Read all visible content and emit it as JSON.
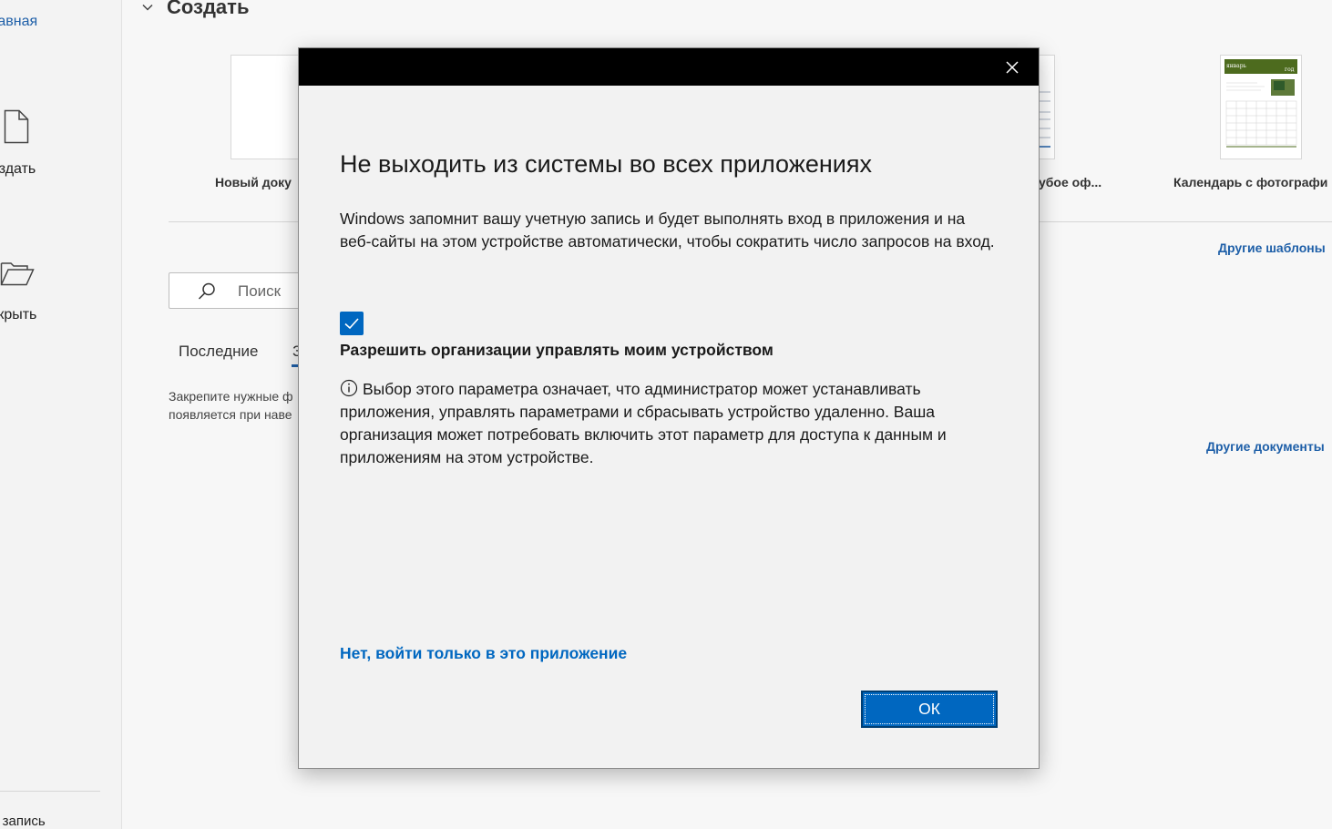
{
  "nav": {
    "home_label": "лавная",
    "create_label": "оздать",
    "open_label": "ткрыть",
    "bottom_label": "ая запись"
  },
  "main": {
    "create_title": "Создать",
    "templates": [
      {
        "label": "Новый доку"
      },
      {
        "label": "убое оф..."
      },
      {
        "label": "Календарь с фотографи"
      }
    ],
    "more_templates_link": "Другие шаблоны",
    "more_docs_link": "Другие документы",
    "search_placeholder": "Поиск",
    "tabs": [
      {
        "label": "Последние"
      },
      {
        "label": "З"
      }
    ],
    "pin_hint_line1": "Закрепите нужные ф",
    "pin_hint_line2": "появляется при наве"
  },
  "dialog": {
    "heading": "Не выходить из системы во всех приложениях",
    "description": "Windows запомнит вашу учетную запись и будет выполнять вход в приложения и на веб-сайты на этом устройстве автоматически, чтобы сократить число запросов на вход.",
    "checkbox_checked": true,
    "checkbox_label": "Разрешить организации управлять моим устройством",
    "info_text": "Выбор этого параметра означает, что администратор может устанавливать приложения, управлять параметрами и сбрасывать устройство удаленно. Ваша организация может потребовать включить этот параметр для доступа к данным и приложениям на этом устройстве.",
    "link_text": "Нет, войти только в это приложение",
    "ok_label": "ОК"
  },
  "colors": {
    "accent": "#0067c0",
    "link": "#1e5fa8",
    "titlebar": "#000000"
  },
  "calendar_thumb": {
    "month": "январь",
    "year": "год"
  }
}
